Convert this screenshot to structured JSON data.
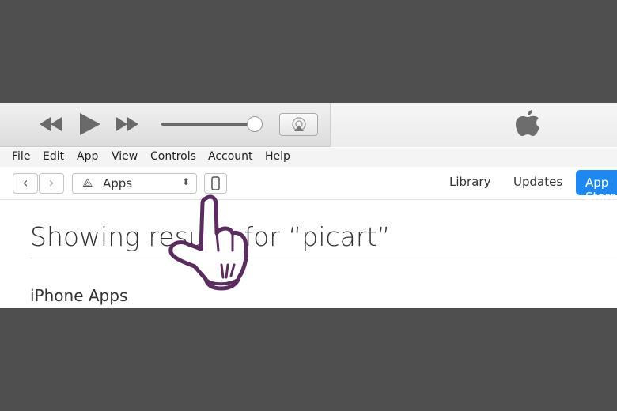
{
  "player": {
    "rewind_icon": "rewind-icon",
    "play_icon": "play-icon",
    "forward_icon": "fast-forward-icon",
    "volume": 0.92,
    "airplay_icon": "airplay-icon",
    "logo": "apple-logo"
  },
  "menu": [
    "File",
    "Edit",
    "App",
    "View",
    "Controls",
    "Account",
    "Help"
  ],
  "toolbar": {
    "media_select": "Apps",
    "tabs": [
      "Library",
      "Updates",
      "App Store"
    ]
  },
  "main": {
    "title": "Showing results for “picart”",
    "section": "iPhone Apps"
  },
  "colors": {
    "accent": "#1e88f0",
    "pointer": "#5a2d5e"
  }
}
